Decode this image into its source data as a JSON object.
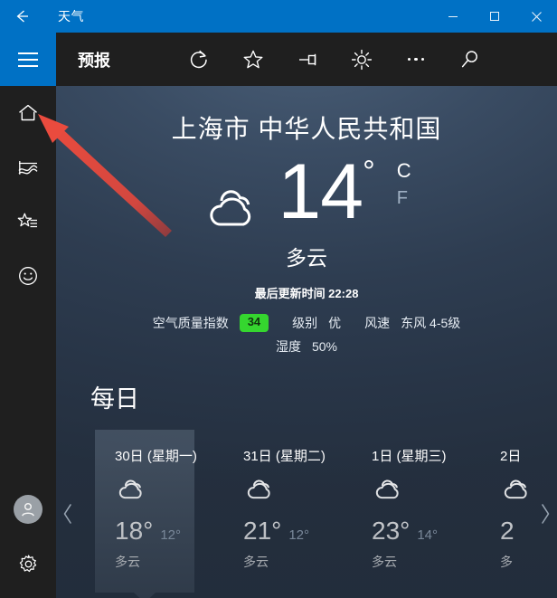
{
  "titlebar": {
    "back_icon": "back-arrow-icon",
    "title": "天气",
    "minimize_label": "–",
    "maximize_label": "□",
    "close_label": "✕"
  },
  "rail": {
    "menu_icon": "hamburger-icon",
    "items": [
      {
        "icon": "home-icon",
        "name": "home"
      },
      {
        "icon": "chart-icon",
        "name": "historical-weather"
      },
      {
        "icon": "star-list-icon",
        "name": "favorites"
      },
      {
        "icon": "smiley-icon",
        "name": "feedback"
      }
    ],
    "account_icon": "account-avatar-icon",
    "settings_icon": "gear-icon"
  },
  "toolbar": {
    "label": "预报",
    "buttons": [
      {
        "icon": "refresh-icon",
        "name": "refresh"
      },
      {
        "icon": "star-icon",
        "name": "add-favorite"
      },
      {
        "icon": "pin-icon",
        "name": "pin-to-start"
      },
      {
        "icon": "sun-icon",
        "name": "change-background"
      },
      {
        "icon": "ellipsis-icon",
        "name": "more-options"
      },
      {
        "icon": "search-icon",
        "name": "search"
      }
    ]
  },
  "current": {
    "location": "上海市 中华人民共和国",
    "icon": "cloudy-icon",
    "temperature": "14",
    "degree_symbol": "°",
    "unit_celsius": "C",
    "unit_fahrenheit": "F",
    "condition": "多云",
    "updated": "最后更新时间 22:28",
    "aqi_label": "空气质量指数",
    "aqi_value": "34",
    "aqi_level_label": "级别",
    "aqi_level_value": "优",
    "wind_label": "风速",
    "wind_value": "东风 4-5级",
    "humidity_label": "湿度",
    "humidity_value": "50%",
    "aqi_color": "#35d62f"
  },
  "forecast": {
    "section_title": "每日",
    "prev_arrow": "‹",
    "next_arrow": "›",
    "days": [
      {
        "day": "30日 (星期一)",
        "icon": "cloudy-icon",
        "high": "18°",
        "low": "12°",
        "condition": "多云",
        "active": true
      },
      {
        "day": "31日 (星期二)",
        "icon": "cloudy-icon",
        "high": "21°",
        "low": "12°",
        "condition": "多云",
        "active": false
      },
      {
        "day": "1日 (星期三)",
        "icon": "cloudy-icon",
        "high": "23°",
        "low": "14°",
        "condition": "多云",
        "active": false
      },
      {
        "day": "2日",
        "icon": "cloudy-icon",
        "high": "2",
        "low": "",
        "condition": "多",
        "active": false
      }
    ]
  },
  "annotation": {
    "arrow_color": "#e04a3f",
    "points_at": "home-icon"
  }
}
